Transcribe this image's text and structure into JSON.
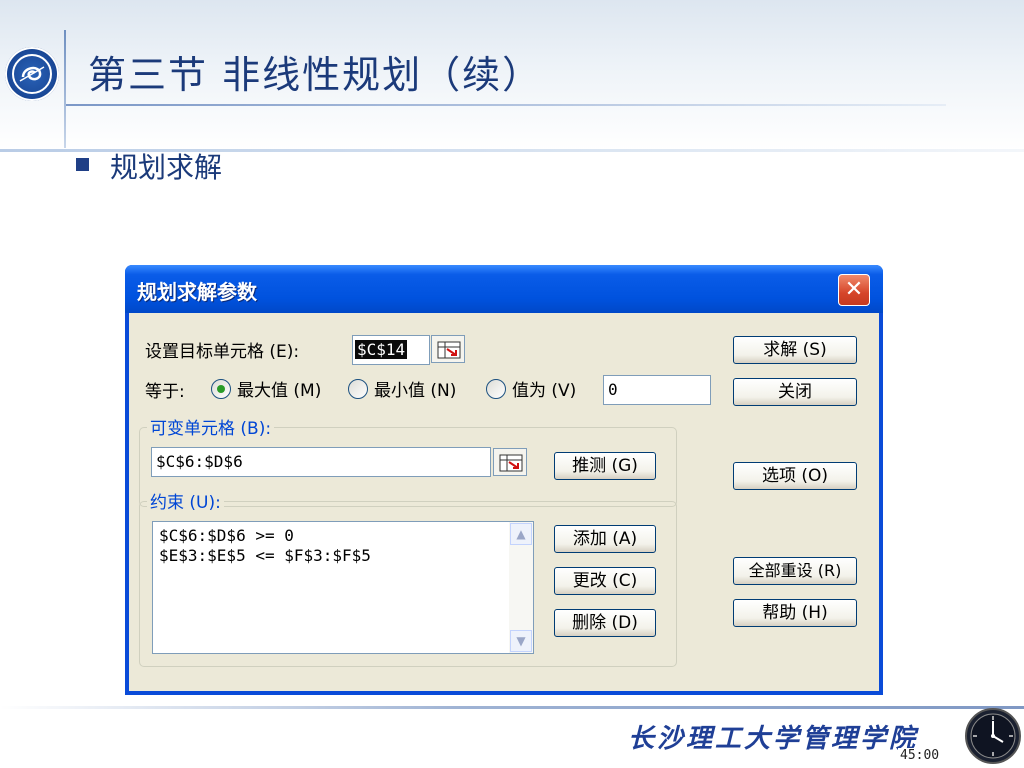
{
  "slide": {
    "title": "第三节  非线性规划（续）",
    "bullet": "规划求解",
    "footer_school": "长沙理工大学管理学院",
    "timer": "45:00"
  },
  "dialog": {
    "title": "规划求解参数",
    "target_label": "设置目标单元格 (E):",
    "target_value": "$C$14",
    "equal_label": "等于:",
    "radio_max": "最大值 (M)",
    "radio_min": "最小值 (N)",
    "radio_value": "值为 (V)",
    "value_input": "0",
    "selected_option": "最大值 (M)",
    "variable_group_label": "可变单元格 (B):",
    "variable_value": "$C$6:$D$6",
    "guess_button": "推测 (G)",
    "constraints_group_label": "约束 (U):",
    "constraints": [
      "$C$6:$D$6 >= 0",
      "$E$3:$E$5 <= $F$3:$F$5"
    ],
    "add_button": "添加 (A)",
    "change_button": "更改 (C)",
    "delete_button": "删除 (D)",
    "solve_button": "求解 (S)",
    "close_button": "关闭",
    "options_button": "选项 (O)",
    "reset_button": "全部重设 (R)",
    "help_button": "帮助 (H)"
  },
  "colors": {
    "title_text": "#1b3a7a",
    "dialog_titlebar": "#0052de",
    "dialog_body": "#ece9d8",
    "group_label": "#0046d5",
    "close_button": "#d6462a"
  },
  "icons": {
    "logo": "university-logo",
    "ref": "range-select-icon",
    "close": "close-icon",
    "clock": "clock-icon"
  }
}
